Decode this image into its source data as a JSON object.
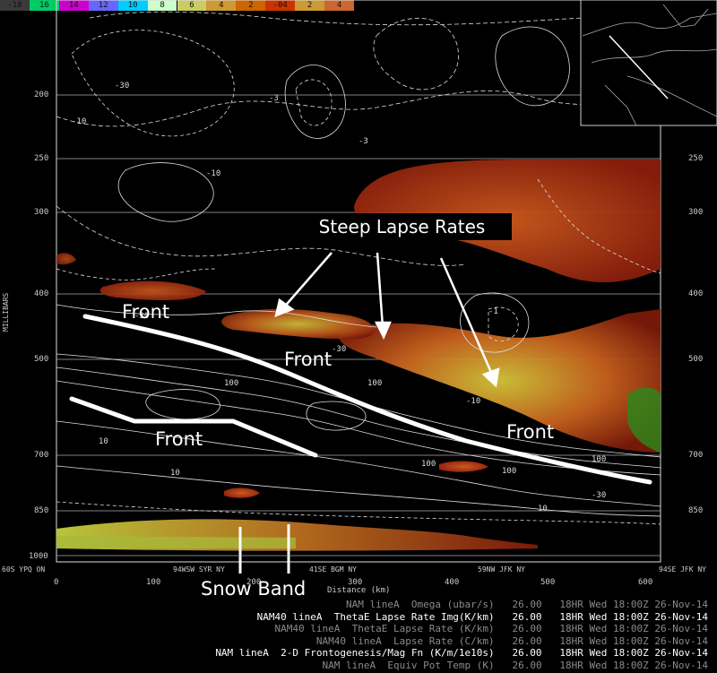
{
  "colorbar": {
    "labels": [
      "-18",
      "16",
      "14",
      "12",
      "10",
      "8",
      "6",
      "4",
      "2",
      "-04",
      "2",
      "4"
    ],
    "colors": [
      "#3a3a3a",
      "#00cc66",
      "#cc00cc",
      "#6666ff",
      "#00ccff",
      "#ccffcc",
      "#cccc66",
      "#cc9933",
      "#cc6600",
      "#cc3300",
      "#cc9933",
      "#cc6633"
    ]
  },
  "y_axis": {
    "title": "MILLIBARS",
    "left_ticks": [
      "200",
      "250",
      "300",
      "400",
      "500",
      "700",
      "850",
      "1000"
    ],
    "right_ticks": [
      "250",
      "300",
      "400",
      "500",
      "700",
      "850"
    ]
  },
  "x_axis": {
    "title": "Distance (km)",
    "ticks": [
      "0",
      "100",
      "200",
      "300",
      "400",
      "500",
      "600"
    ]
  },
  "stations": [
    "60S YPQ ON",
    "94WSW SYR NY",
    "41SE BGM NY",
    "59NW JFK NY",
    "94SE JFK NY"
  ],
  "annotations": {
    "steep_lapse": "Steep Lapse Rates",
    "front_1": "Front",
    "front_2": "Front",
    "front_3": "Front",
    "front_4": "Front",
    "snow_band": "Snow Band"
  },
  "legend": [
    {
      "text": "NAM lineA  Omega (ubar/s)   26.00   18HR Wed 18:00Z 26-Nov-14",
      "color": "#8a8a8a"
    },
    {
      "text": "NAM40 lineA  ThetaE Lapse Rate Img(K/km)   26.00   18HR Wed 18:00Z 26-Nov-14",
      "color": "#ffffff"
    },
    {
      "text": "NAM40 lineA  ThetaE Lapse Rate (K/km)   26.00   18HR Wed 18:00Z 26-Nov-14",
      "color": "#8a8a8a"
    },
    {
      "text": "NAM40 lineA  Lapse Rate (C/km)   26.00   18HR Wed 18:00Z 26-Nov-14",
      "color": "#8a8a8a"
    },
    {
      "text": "NAM lineA  2-D Frontogenesis/Mag Fn (K/m/1e10s)   26.00   18HR Wed 18:00Z 26-Nov-14",
      "color": "#ffffff"
    },
    {
      "text": "NAM lineA  Equiv Pot Temp (K)   26.00   18HR Wed 18:00Z 26-Nov-14",
      "color": "#8a8a8a"
    }
  ]
}
